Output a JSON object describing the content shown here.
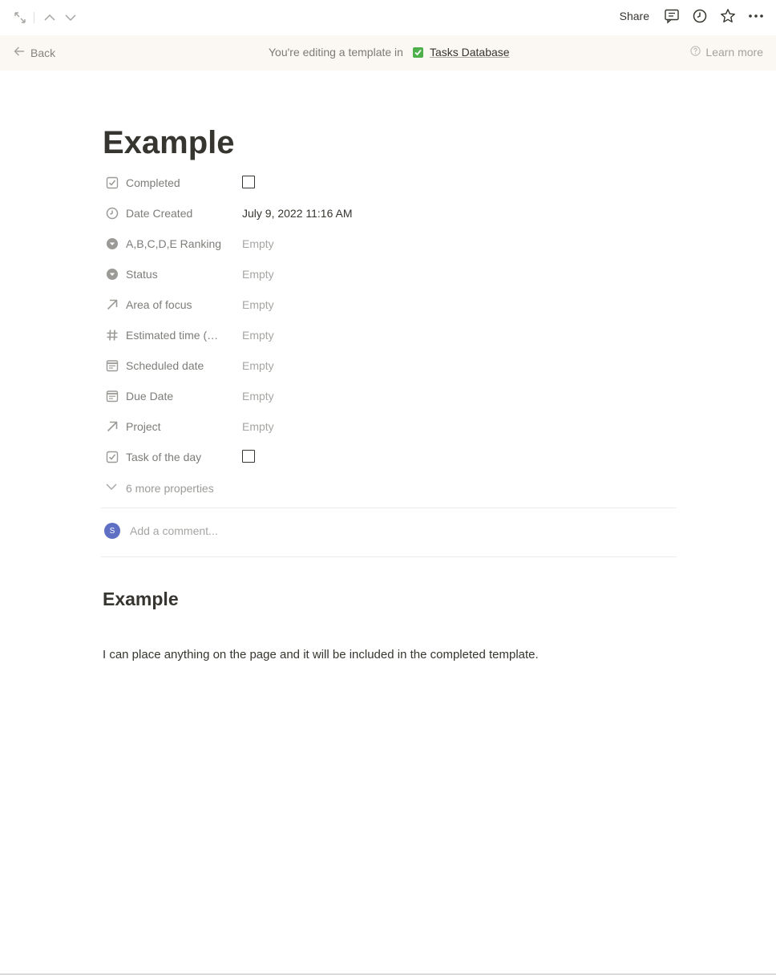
{
  "topbar": {
    "expand_icon": "expand-diagonal-icon",
    "up_icon": "chevron-up-icon",
    "down_icon": "chevron-down-icon",
    "share_label": "Share",
    "comments_icon": "comment-icon",
    "updates_icon": "clock-icon",
    "favorite_icon": "star-icon",
    "more_icon": "ellipsis-icon"
  },
  "banner": {
    "back_label": "Back",
    "editing_text": "You're editing a template in",
    "database_name": "Tasks Database",
    "learn_more_label": "Learn more"
  },
  "page": {
    "title": "Example",
    "properties": [
      {
        "name": "Completed",
        "icon": "checkbox-icon",
        "type": "checkbox",
        "value": ""
      },
      {
        "name": "Date Created",
        "icon": "clock-icon",
        "type": "text",
        "value": "July 9, 2022 11:16 AM"
      },
      {
        "name": "A,B,C,D,E Ranking",
        "icon": "select-icon",
        "type": "empty",
        "value": "Empty"
      },
      {
        "name": "Status",
        "icon": "select-icon",
        "type": "empty",
        "value": "Empty"
      },
      {
        "name": "Area of focus",
        "icon": "relation-arrow-icon",
        "type": "empty",
        "value": "Empty"
      },
      {
        "name": "Estimated time (H...",
        "icon": "number-hash-icon",
        "type": "empty",
        "value": "Empty"
      },
      {
        "name": "Scheduled date",
        "icon": "calendar-icon",
        "type": "empty",
        "value": "Empty"
      },
      {
        "name": "Due Date",
        "icon": "calendar-icon",
        "type": "empty",
        "value": "Empty"
      },
      {
        "name": "Project",
        "icon": "relation-arrow-icon",
        "type": "empty",
        "value": "Empty"
      },
      {
        "name": "Task of the day",
        "icon": "checkbox-icon",
        "type": "checkbox",
        "value": ""
      }
    ],
    "more_properties_label": "6 more properties",
    "comment": {
      "avatar_initial": "S",
      "placeholder": "Add a comment..."
    },
    "heading": "Example",
    "paragraph": "I can place anything on the page and it will be included in the completed template."
  }
}
